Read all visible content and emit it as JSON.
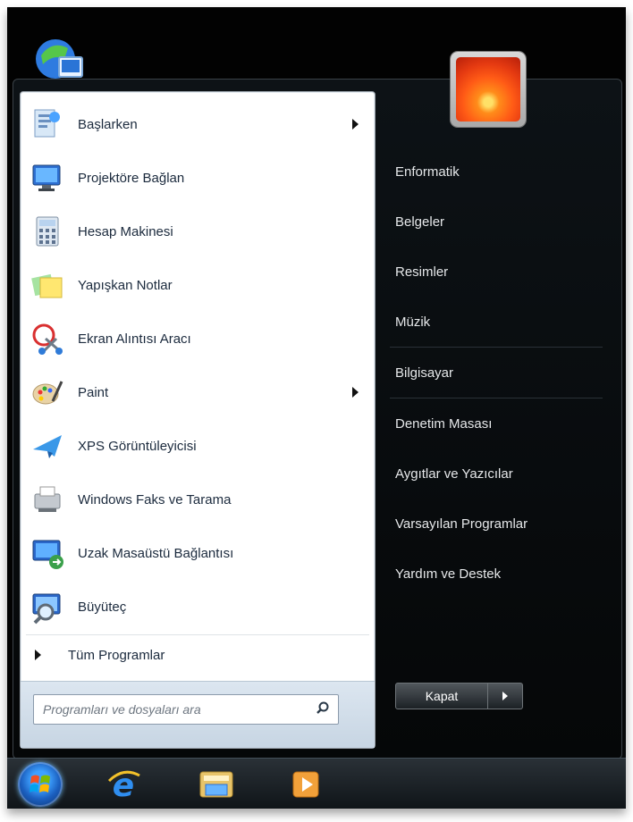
{
  "left_programs": [
    {
      "label": "Başlarken",
      "icon": "getting-started-icon",
      "has_submenu": true
    },
    {
      "label": "Projektöre Bağlan",
      "icon": "projector-icon",
      "has_submenu": false
    },
    {
      "label": "Hesap Makinesi",
      "icon": "calculator-icon",
      "has_submenu": false
    },
    {
      "label": "Yapışkan Notlar",
      "icon": "sticky-notes-icon",
      "has_submenu": false
    },
    {
      "label": "Ekran Alıntısı Aracı",
      "icon": "snipping-tool-icon",
      "has_submenu": false
    },
    {
      "label": "Paint",
      "icon": "paint-icon",
      "has_submenu": true
    },
    {
      "label": "XPS Görüntüleyicisi",
      "icon": "xps-viewer-icon",
      "has_submenu": false
    },
    {
      "label": "Windows Faks ve Tarama",
      "icon": "fax-scan-icon",
      "has_submenu": false
    },
    {
      "label": "Uzak Masaüstü Bağlantısı",
      "icon": "remote-desktop-icon",
      "has_submenu": false
    },
    {
      "label": "Büyüteç",
      "icon": "magnifier-icon",
      "has_submenu": false
    }
  ],
  "all_programs_label": "Tüm Programlar",
  "search": {
    "placeholder": "Programları ve dosyaları ara"
  },
  "right_items": [
    {
      "label": "Enformatik"
    },
    {
      "label": "Belgeler"
    },
    {
      "label": "Resimler"
    },
    {
      "label": "Müzik"
    },
    {
      "label": "Bilgisayar"
    },
    {
      "label": "Denetim Masası"
    },
    {
      "label": "Aygıtlar ve Yazıcılar"
    },
    {
      "label": "Varsayılan Programlar"
    },
    {
      "label": "Yardım ve Destek"
    }
  ],
  "shutdown": {
    "label": "Kapat"
  },
  "taskbar": {
    "items": [
      "start-orb",
      "internet-explorer-icon",
      "windows-explorer-icon",
      "media-player-icon"
    ]
  },
  "colors": {
    "text_dark": "#1b2a3d",
    "text_light": "#e6e8ea",
    "accent_blue": "#1b5fbf"
  }
}
